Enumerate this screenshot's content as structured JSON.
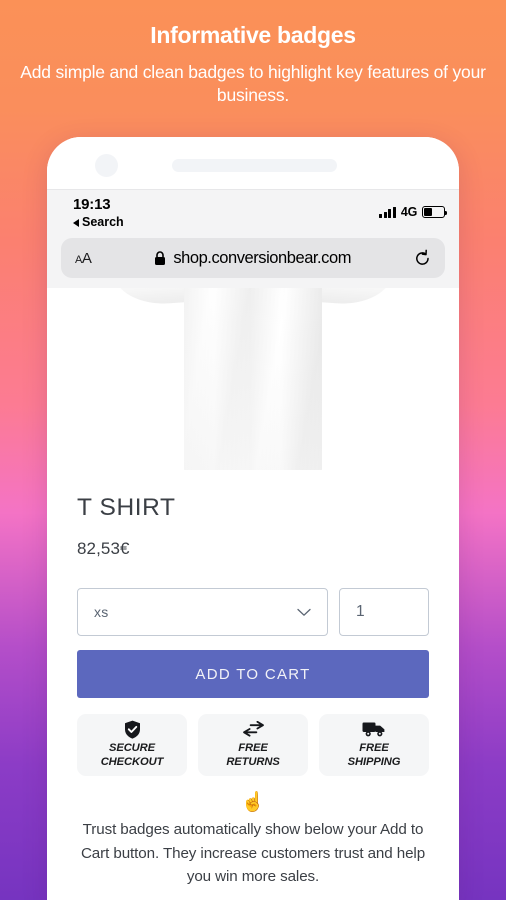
{
  "promo": {
    "title": "Informative badges",
    "subtitle": "Add simple and clean badges to highlight key features of your business."
  },
  "phone": {
    "status": {
      "time": "19:13",
      "back_label": "Search",
      "network": "4G",
      "battery_level": 40,
      "signal_bars": 4
    },
    "browser": {
      "text_size_label": "A",
      "text_size_label_small": "A",
      "url": "shop.conversionbear.com",
      "lock_icon": "lock-icon",
      "reload_icon": "reload-icon"
    }
  },
  "product": {
    "title": "T SHIRT",
    "price": "82,53€",
    "variant_selected": "xs",
    "variant_chevron_icon": "chevron-down-icon",
    "quantity": "1",
    "add_to_cart_label": "ADD TO CART",
    "badges": [
      {
        "icon": "shield-check-icon",
        "line1": "SECURE",
        "line2": "CHECKOUT"
      },
      {
        "icon": "exchange-arrows-icon",
        "line1": "FREE",
        "line2": "RETURNS"
      },
      {
        "icon": "delivery-truck-icon",
        "line1": "FREE",
        "line2": "SHIPPING"
      }
    ]
  },
  "footer": {
    "pointer_emoji": "☝️",
    "blurb": "Trust badges automatically show below your Add to Cart button. They increase customers trust and help you win more sales."
  },
  "colors": {
    "gradient_top": "#fb9157",
    "gradient_mid": "#fc7b93",
    "gradient_bottom": "#7634c0",
    "accent_button": "#5c68be",
    "badge_bg": "#f5f6f7",
    "input_border": "#c3cad4"
  }
}
